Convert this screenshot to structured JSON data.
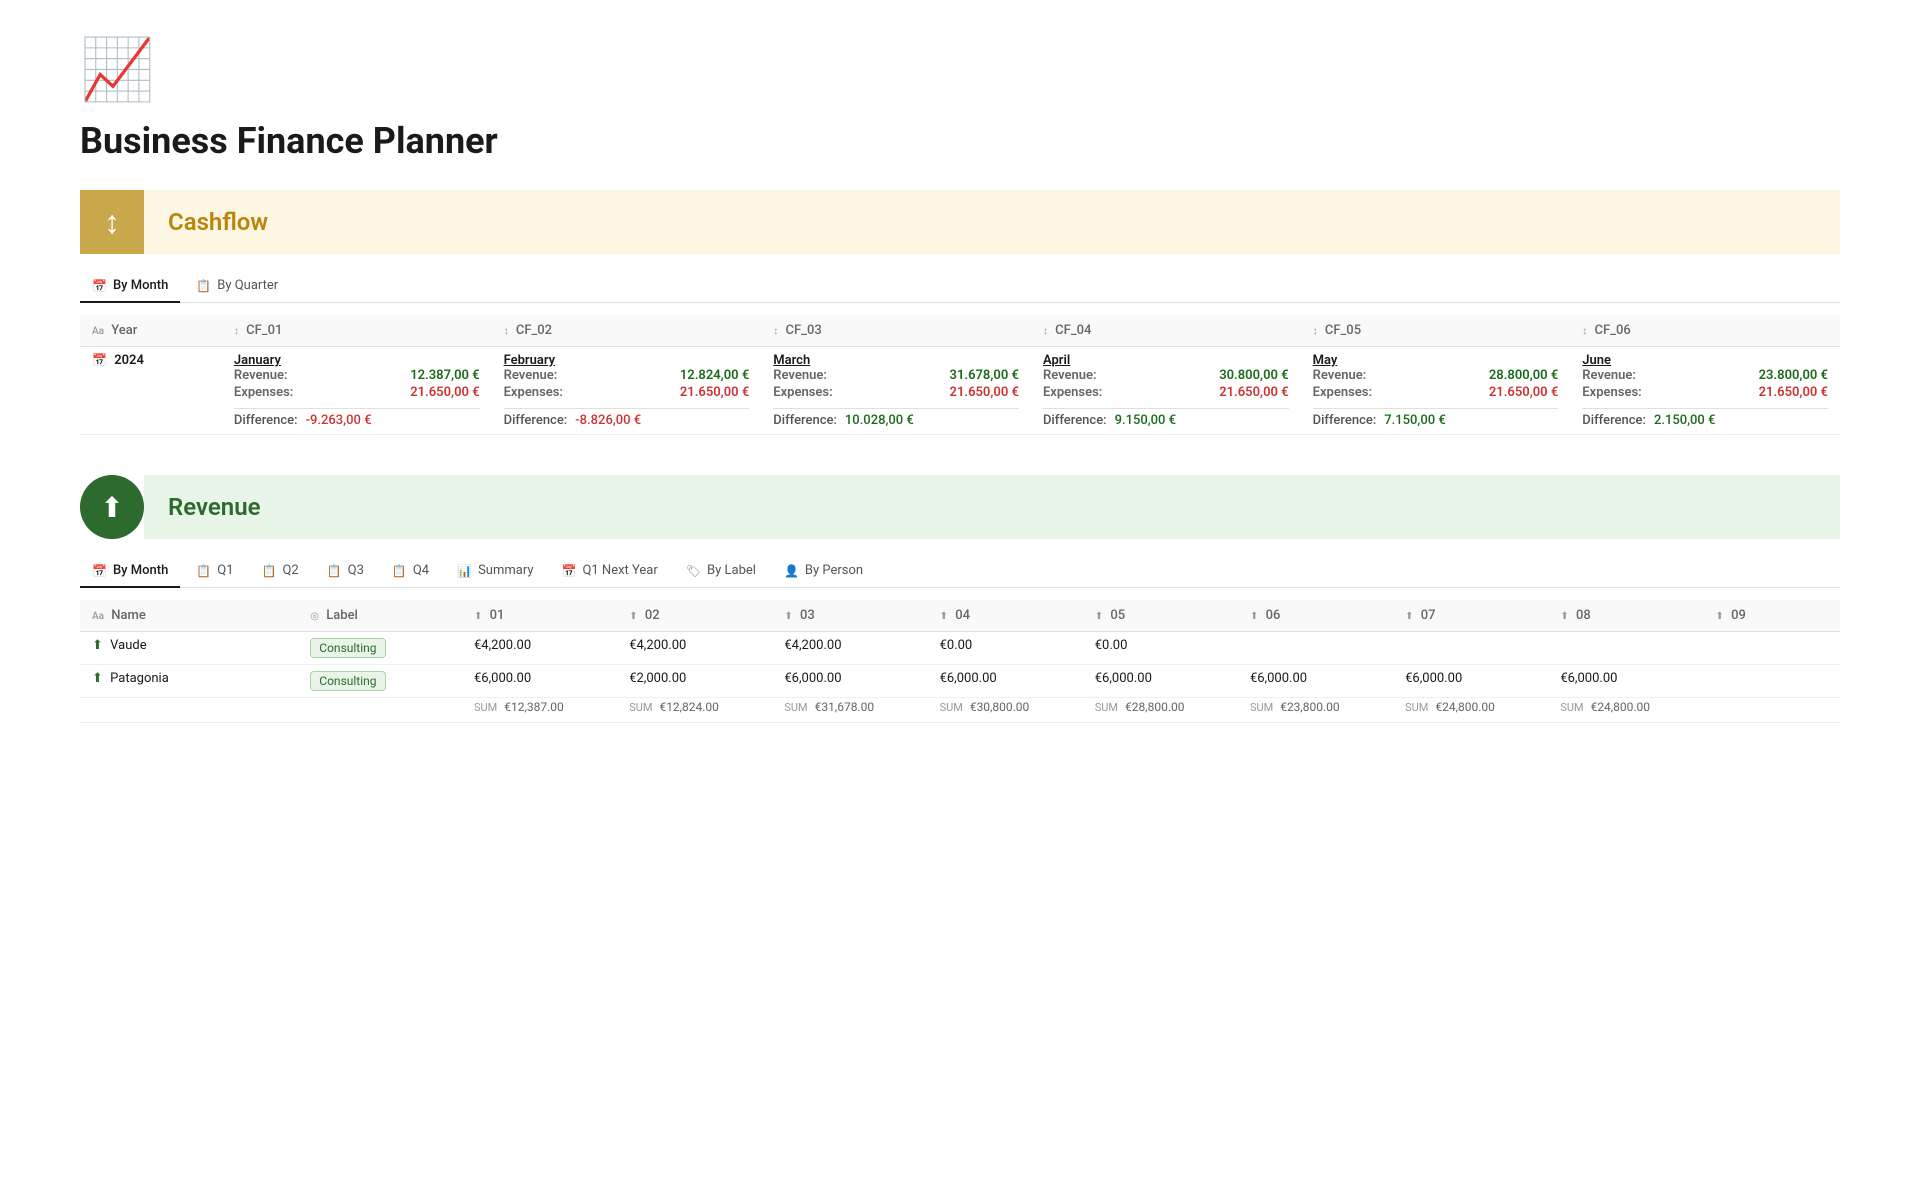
{
  "page": {
    "logo_icon": "📈",
    "title": "Business Finance Planner"
  },
  "cashflow": {
    "section_icon": "↕",
    "section_title": "Cashflow",
    "tabs": [
      {
        "id": "by-month",
        "label": "By Month",
        "icon": "📅",
        "active": true
      },
      {
        "id": "by-quarter",
        "label": "By Quarter",
        "icon": "📋",
        "active": false
      }
    ],
    "columns": [
      {
        "id": "year",
        "label": "Year",
        "sort": false
      },
      {
        "id": "cf_01",
        "label": "CF_01",
        "sort": true
      },
      {
        "id": "cf_02",
        "label": "CF_02",
        "sort": true
      },
      {
        "id": "cf_03",
        "label": "CF_03",
        "sort": true
      },
      {
        "id": "cf_04",
        "label": "CF_04",
        "sort": true
      },
      {
        "id": "cf_05",
        "label": "CF_05",
        "sort": true
      },
      {
        "id": "cf_06",
        "label": "CF_06",
        "sort": true
      }
    ],
    "rows": [
      {
        "year": "2024",
        "months": [
          {
            "name": "January",
            "revenue": "12.387,00 €",
            "expenses": "21.650,00 €",
            "difference": "-9.263,00 €",
            "diff_type": "negative"
          },
          {
            "name": "February",
            "revenue": "12.824,00 €",
            "expenses": "21.650,00 €",
            "difference": "-8.826,00 €",
            "diff_type": "negative"
          },
          {
            "name": "March",
            "revenue": "31.678,00 €",
            "expenses": "21.650,00 €",
            "difference": "10.028,00 €",
            "diff_type": "positive"
          },
          {
            "name": "April",
            "revenue": "30.800,00 €",
            "expenses": "21.650,00 €",
            "difference": "9.150,00 €",
            "diff_type": "positive"
          },
          {
            "name": "May",
            "revenue": "28.800,00 €",
            "expenses": "21.650,00 €",
            "difference": "7.150,00 €",
            "diff_type": "positive"
          },
          {
            "name": "June",
            "revenue": "23.800,00 €",
            "expenses": "21.650,00 €",
            "difference": "2.150,00 €",
            "diff_type": "positive"
          }
        ]
      }
    ]
  },
  "revenue": {
    "section_icon": "⬆",
    "section_title": "Revenue",
    "tabs": [
      {
        "id": "by-month",
        "label": "By Month",
        "icon": "📅",
        "active": true
      },
      {
        "id": "q1",
        "label": "Q1",
        "icon": "📋",
        "active": false
      },
      {
        "id": "q2",
        "label": "Q2",
        "icon": "📋",
        "active": false
      },
      {
        "id": "q3",
        "label": "Q3",
        "icon": "📋",
        "active": false
      },
      {
        "id": "q4",
        "label": "Q4",
        "icon": "📋",
        "active": false
      },
      {
        "id": "summary",
        "label": "Summary",
        "icon": "📊",
        "active": false
      },
      {
        "id": "q1-next-year",
        "label": "Q1 Next Year",
        "icon": "📅",
        "active": false
      },
      {
        "id": "by-label",
        "label": "By Label",
        "icon": "🏷",
        "active": false
      },
      {
        "id": "by-person",
        "label": "By Person",
        "icon": "👤",
        "active": false
      }
    ],
    "columns": [
      {
        "id": "name",
        "label": "Name",
        "sort": false
      },
      {
        "id": "label",
        "label": "Label",
        "sort": false
      },
      {
        "id": "01",
        "label": "01",
        "sort": false
      },
      {
        "id": "02",
        "label": "02",
        "sort": false
      },
      {
        "id": "03",
        "label": "03",
        "sort": false
      },
      {
        "id": "04",
        "label": "04",
        "sort": false
      },
      {
        "id": "05",
        "label": "05",
        "sort": false
      },
      {
        "id": "06",
        "label": "06",
        "sort": false
      },
      {
        "id": "07",
        "label": "07",
        "sort": false
      },
      {
        "id": "08",
        "label": "08",
        "sort": false
      },
      {
        "id": "09",
        "label": "09",
        "sort": false
      }
    ],
    "rows": [
      {
        "name": "Vaude",
        "label": "Consulting",
        "values": [
          "€4,200.00",
          "€4,200.00",
          "€4,200.00",
          "€0.00",
          "€0.00",
          "",
          "",
          "",
          ""
        ]
      },
      {
        "name": "Patagonia",
        "label": "Consulting",
        "values": [
          "€6,000.00",
          "€2,000.00",
          "€6,000.00",
          "€6,000.00",
          "€6,000.00",
          "€6,000.00",
          "€6,000.00",
          "€6,000.00",
          ""
        ]
      }
    ],
    "sum_row": {
      "values": [
        "€12,387.00",
        "€12,824.00",
        "€31,678.00",
        "€30,800.00",
        "€28,800.00",
        "€23,800.00",
        "€24,800.00",
        "€24,800.00",
        ""
      ]
    }
  }
}
